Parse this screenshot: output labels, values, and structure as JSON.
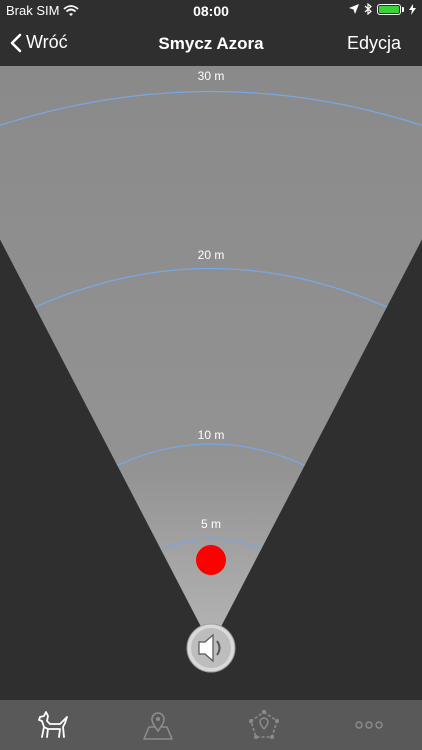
{
  "status_bar": {
    "carrier": "Brak SIM",
    "time": "08:00",
    "battery_level": 1.0,
    "icons": [
      "wifi-icon",
      "location-arrow-icon",
      "bluetooth-icon",
      "battery-icon",
      "charging-icon"
    ]
  },
  "nav": {
    "back_label": "Wróć",
    "title": "Smycz Azora",
    "edit_label": "Edycja"
  },
  "radar": {
    "rings": [
      {
        "label": "30 m",
        "distance_m": 30
      },
      {
        "label": "20 m",
        "distance_m": 20
      },
      {
        "label": "10 m",
        "distance_m": 10
      },
      {
        "label": "5 m",
        "distance_m": 5
      }
    ],
    "target_distance_m": 2.5,
    "colors": {
      "cone": "#8f8f8f",
      "ring": "#7aa6e0",
      "target": "#ff0000",
      "background": "#2f2f2f"
    }
  },
  "sound_button": {
    "icon": "speaker-icon"
  },
  "tabs": [
    {
      "name": "dog",
      "icon": "dog-icon",
      "active": true
    },
    {
      "name": "map",
      "icon": "map-pin-icon",
      "active": false
    },
    {
      "name": "zone",
      "icon": "geofence-icon",
      "active": false
    },
    {
      "name": "more",
      "icon": "more-icon",
      "active": false
    }
  ]
}
